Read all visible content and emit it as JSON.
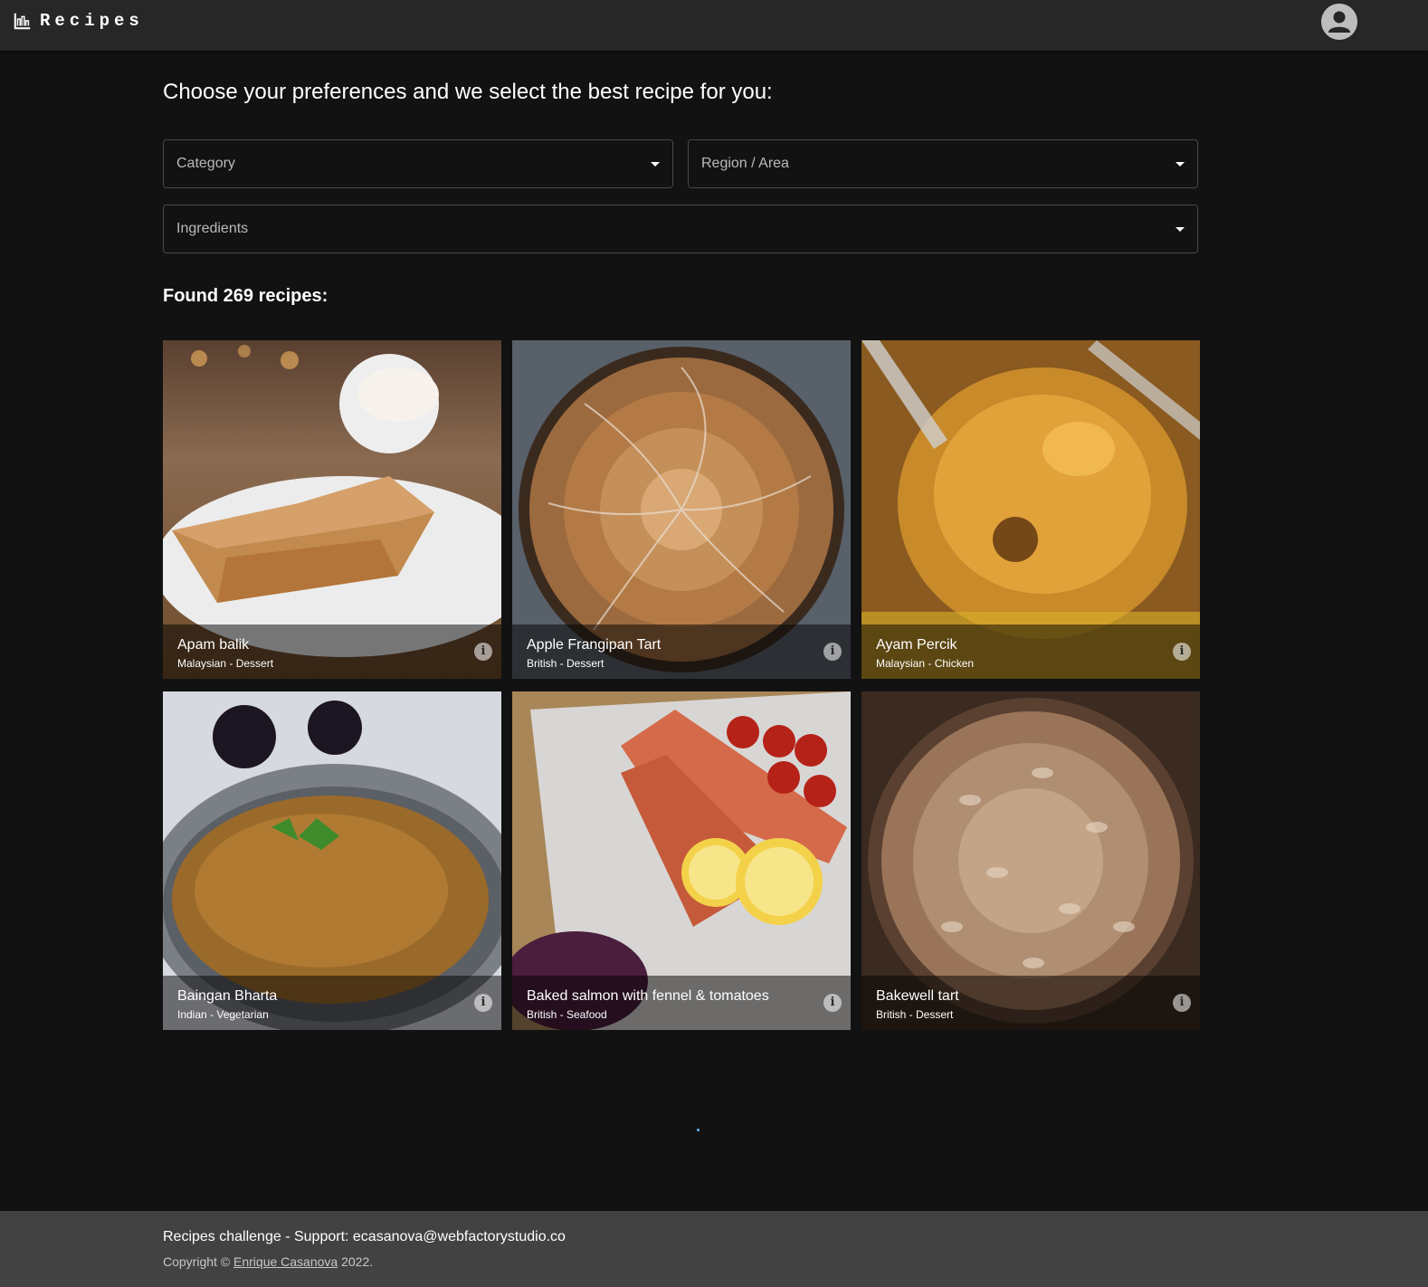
{
  "header": {
    "title": "Recipes",
    "brand_icon": "chart-icon",
    "account_icon": "account-circle-icon"
  },
  "main": {
    "headline": "Choose your preferences and we select the best recipe for you:",
    "filters": {
      "category": {
        "label": "Category",
        "value": ""
      },
      "region": {
        "label": "Region / Area",
        "value": ""
      },
      "ingredients": {
        "label": "Ingredients",
        "value": ""
      }
    },
    "found_text": "Found 269 recipes:",
    "recipes": [
      {
        "title": "Apam balik",
        "subtitle": "Malaysian - Dessert",
        "info_icon": "info-icon"
      },
      {
        "title": "Apple Frangipan Tart",
        "subtitle": "British - Dessert",
        "info_icon": "info-icon"
      },
      {
        "title": "Ayam Percik",
        "subtitle": "Malaysian - Chicken",
        "info_icon": "info-icon"
      },
      {
        "title": "Baingan Bharta",
        "subtitle": "Indian - Vegetarian",
        "info_icon": "info-icon"
      },
      {
        "title": "Baked salmon with fennel & tomatoes",
        "subtitle": "British - Seafood",
        "info_icon": "info-icon"
      },
      {
        "title": "Bakewell tart",
        "subtitle": "British - Dessert",
        "info_icon": "info-icon"
      }
    ]
  },
  "footer": {
    "line1": "Recipes challenge - Support: ecasanova@webfactorystudio.co",
    "copyright_prefix": "Copyright ©",
    "author": "Enrique Casanova",
    "year": "2022."
  },
  "colors": {
    "background": "#121212",
    "appbar": "#272727",
    "footer": "#424242",
    "spinner": "#64b5f6"
  }
}
